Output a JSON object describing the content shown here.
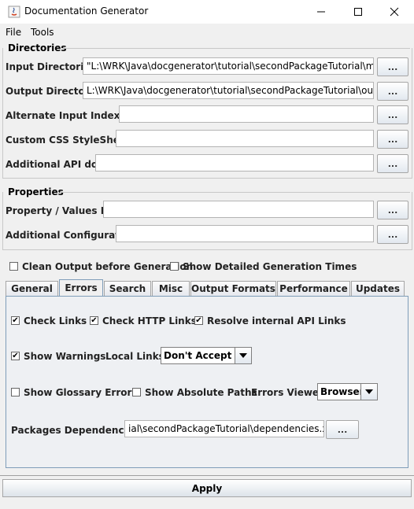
{
  "window": {
    "title": "Documentation Generator",
    "controls": [
      "minimize-icon",
      "maximize-icon",
      "close-icon"
    ]
  },
  "menubar": [
    "File",
    "Tools"
  ],
  "directories": {
    "title": "Directories",
    "rows": [
      {
        "label": "Input Directories",
        "value": "\"L:\\WRK\\Java\\docgenerator\\tutorial\\secondPackageTutorial\\main\"",
        "button": "..."
      },
      {
        "label": "Output Directory",
        "value": "L:\\WRK\\Java\\docgenerator\\tutorial\\secondPackageTutorial\\output",
        "button": "..."
      },
      {
        "label": "Alternate Input Index File",
        "value": "",
        "button": "..."
      },
      {
        "label": "Custom CSS StyleSheet",
        "value": "",
        "button": "..."
      },
      {
        "label": "Additional API docs",
        "value": "",
        "button": "..."
      }
    ]
  },
  "properties": {
    "title": "Properties",
    "rows": [
      {
        "label": "Property / Values File",
        "value": "",
        "button": "..."
      },
      {
        "label": "Additional Configuration",
        "value": "",
        "button": "..."
      }
    ]
  },
  "options": {
    "clean_output": {
      "label": "Clean Output before Generation",
      "checked": false
    },
    "show_times": {
      "label": "Show Detailed Generation Times",
      "checked": false
    }
  },
  "tabs": [
    "General",
    "Errors",
    "Search",
    "Misc",
    "Output Formats",
    "Performance",
    "Updates"
  ],
  "selected_tab": "Errors",
  "errors_panel": {
    "check_links": {
      "label": "Check Links",
      "checked": true
    },
    "check_http_links": {
      "label": "Check HTTP Links",
      "checked": true
    },
    "resolve_internal": {
      "label": "Resolve internal API Links",
      "checked": true
    },
    "show_warnings": {
      "label": "Show Warnings",
      "checked": true
    },
    "local_links": {
      "label": "Local Links",
      "value": "Don't Accept"
    },
    "show_glossary_errors": {
      "label": "Show Glossary Errors",
      "checked": false
    },
    "show_absolute_paths": {
      "label": "Show Absolute Paths",
      "checked": false
    },
    "errors_viewer": {
      "label": "Errors Viewer",
      "value": "Browser"
    },
    "packages_dependencies": {
      "label": "Packages Dependencies",
      "value": "ial\\secondPackageTutorial\\dependencies.xml",
      "button": "..."
    }
  },
  "apply_label": "Apply"
}
